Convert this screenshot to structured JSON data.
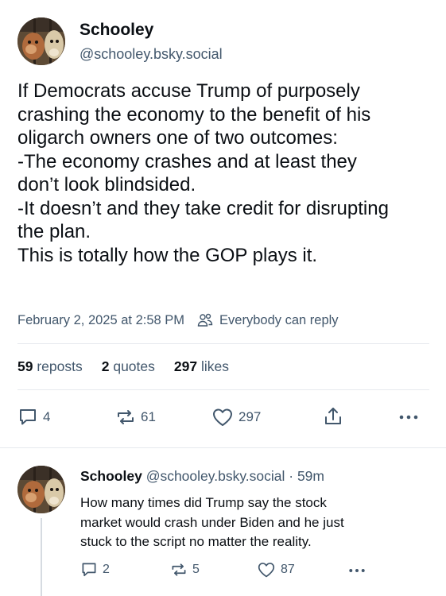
{
  "post": {
    "author": {
      "display_name": "Schooley",
      "handle": "@schooley.bsky.social"
    },
    "text_lines": [
      "If Democrats accuse Trump of purposely",
      "crashing the economy to the benefit of his",
      "oligarch owners one of two outcomes:",
      "-The economy crashes and at least they",
      "don’t look blindsided.",
      "-It doesn’t and they take credit for disrupting",
      "the plan.",
      "This is totally how the GOP plays it."
    ],
    "timestamp": "February 2, 2025 at 2:58 PM",
    "reply_setting": "Everybody can reply",
    "stats": {
      "reposts_count": "59",
      "reposts_label": "reposts",
      "quotes_count": "2",
      "quotes_label": "quotes",
      "likes_count": "297",
      "likes_label": "likes"
    },
    "actions": {
      "reply_count": "4",
      "repost_count": "61",
      "like_count": "297"
    }
  },
  "reply": {
    "display_name": "Schooley",
    "handle": "@schooley.bsky.social",
    "separator": "·",
    "time": "59m",
    "text_lines": [
      "How many times did Trump say the stock",
      "market would crash under Biden and he just",
      "stuck to the script no matter the reality."
    ],
    "actions": {
      "reply_count": "2",
      "repost_count": "5",
      "like_count": "87"
    }
  },
  "icons": {
    "reply": "speech-bubble-icon",
    "repost": "repost-arrows-icon",
    "like": "heart-icon",
    "share": "share-upload-icon",
    "more": "more-dots-icon",
    "reply_setting": "people-icon"
  },
  "colors": {
    "text": "#0b0f14",
    "muted": "#42576c",
    "divider": "#e6e9ee"
  }
}
